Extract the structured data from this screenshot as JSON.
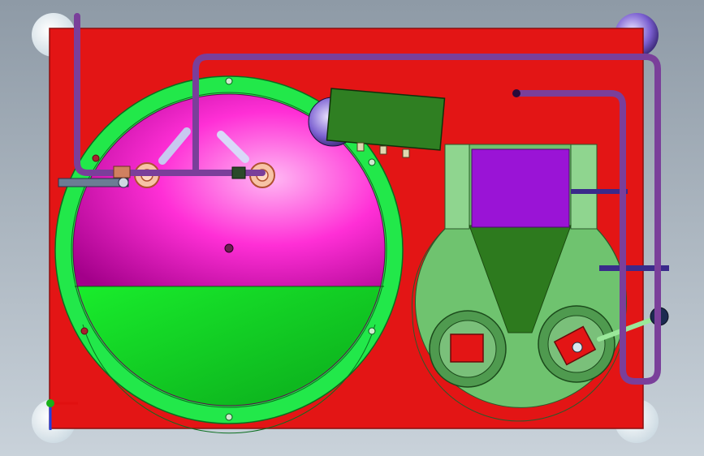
{
  "viewport": {
    "background_top": "#8e9aa6",
    "background_bottom": "#c9d2da"
  },
  "colors": {
    "plate": "#e31515",
    "plate_edge": "#8a0f0f",
    "ring": "#22e84a",
    "ring_edge": "#0a6e1e",
    "dome_light": "#ffb8f3",
    "dome_mid": "#ff2fd6",
    "dome_dark": "#a3008a",
    "liquid": "#19ee2c",
    "liquid_dark": "#0aa41a",
    "hopper_pale": "#6fc36f",
    "hopper_dark": "#2d7a1e",
    "bin_purple": "#9a14d6",
    "pipe": "#7a3f9a",
    "pipe_dark": "#3d1452",
    "motor": "#2f7f22",
    "disc": "#c8d7e0",
    "rod": "#6b7c94",
    "triad_x": "#e01010",
    "triad_y": "#18b018",
    "triad_z": "#2040e0"
  },
  "icons": {
    "corner_markers": "sphere-marker-icon",
    "triad": "coordinate-triad-icon"
  }
}
